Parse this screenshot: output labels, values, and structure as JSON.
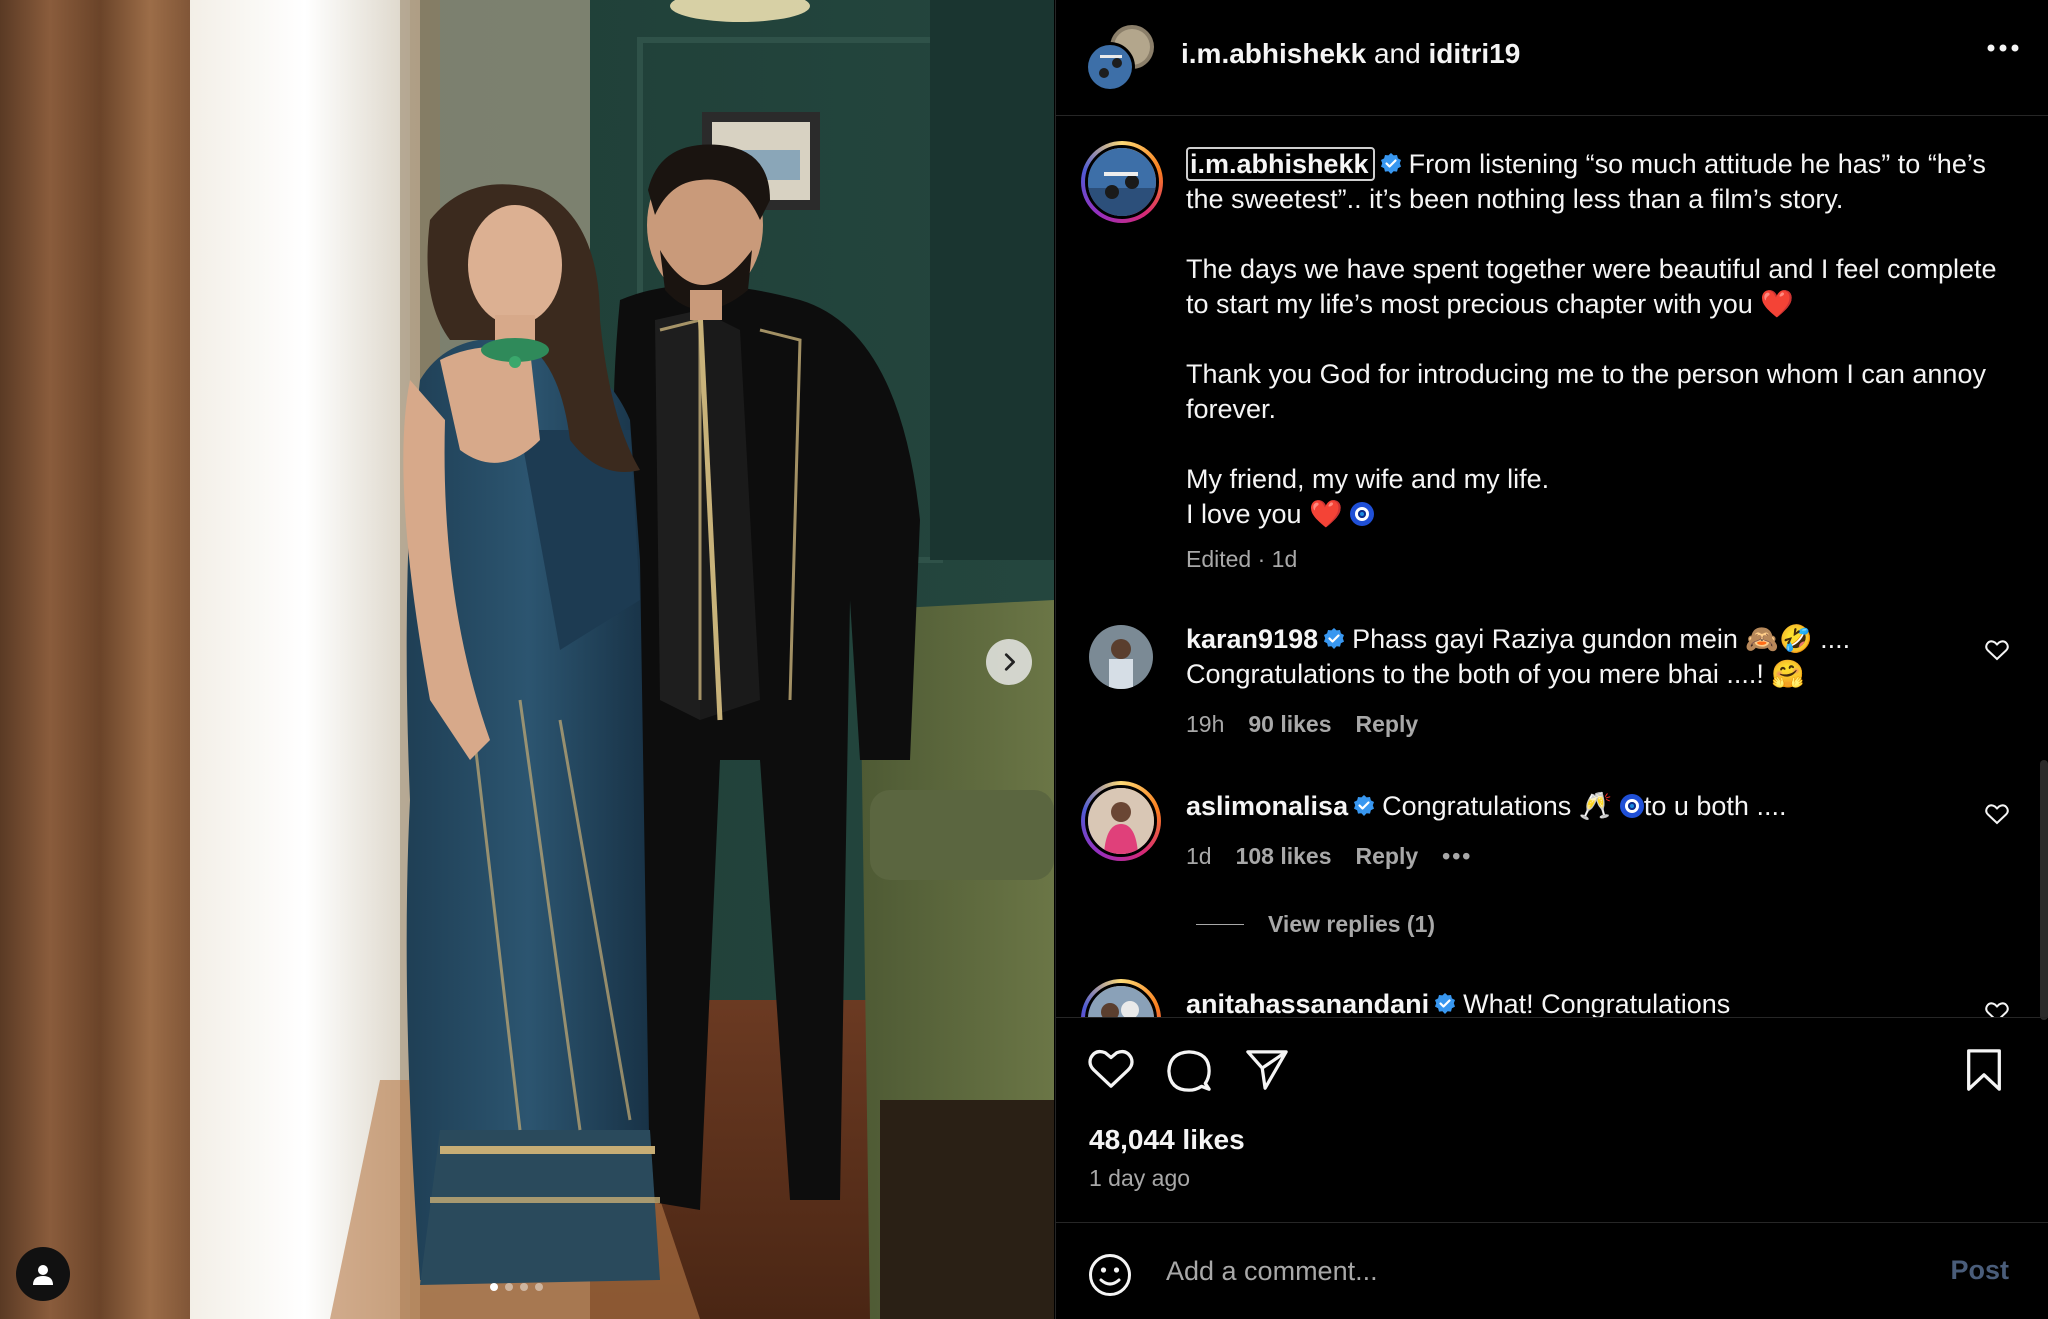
{
  "header": {
    "author_1": "i.m.abhishekk",
    "joiner": "and",
    "author_2": "iditri19",
    "more_icon": "more-horizontal-icon"
  },
  "caption": {
    "username": "i.m.abhishekk",
    "line_1": "From listening “so much attitude he has” to “he’s the sweetest”.. it’s been nothing less than a film’s story.",
    "line_2": "The days we have spent together were beautiful and I feel complete to start my life’s most precious chapter with you",
    "line_2_emoji": "❤️",
    "line_3": "Thank you God for introducing me to the person whom I can annoy forever.",
    "line_4": "My friend, my wife and my life.",
    "line_5": "I love you",
    "line_5_emoji": "❤️",
    "meta": "Edited · 1d"
  },
  "comments": [
    {
      "username": "karan9198",
      "text": "Phass gayi Raziya gundon mein 🙈🤣 .... Congratulations to the both of you mere bhai ....! 🤗",
      "time": "19h",
      "likes": "90 likes",
      "reply_label": "Reply"
    },
    {
      "username": "aslimonalisa",
      "text_before": "Congratulations 🥂",
      "text_after": "to u both ....",
      "time": "1d",
      "likes": "108 likes",
      "reply_label": "Reply",
      "more_label": "•••",
      "view_replies": "View replies (1)"
    },
    {
      "username": "anitahassanandani",
      "text": "What! Congratulations"
    }
  ],
  "actions": {
    "like_icon": "heart-icon",
    "comment_icon": "comment-bubble-icon",
    "share_icon": "send-icon",
    "save_icon": "bookmark-icon",
    "likes": "48,044 likes",
    "posted": "1 day ago"
  },
  "composer": {
    "placeholder": "Add a comment...",
    "post_label": "Post"
  },
  "media": {
    "carousel_index": 1,
    "carousel_count": 4
  },
  "colors": {
    "background": "#000000",
    "text": "#f5f5f5",
    "secondary_text": "#a8a8a8",
    "verified": "#3897f0",
    "post_disabled": "#4a5d7a"
  }
}
